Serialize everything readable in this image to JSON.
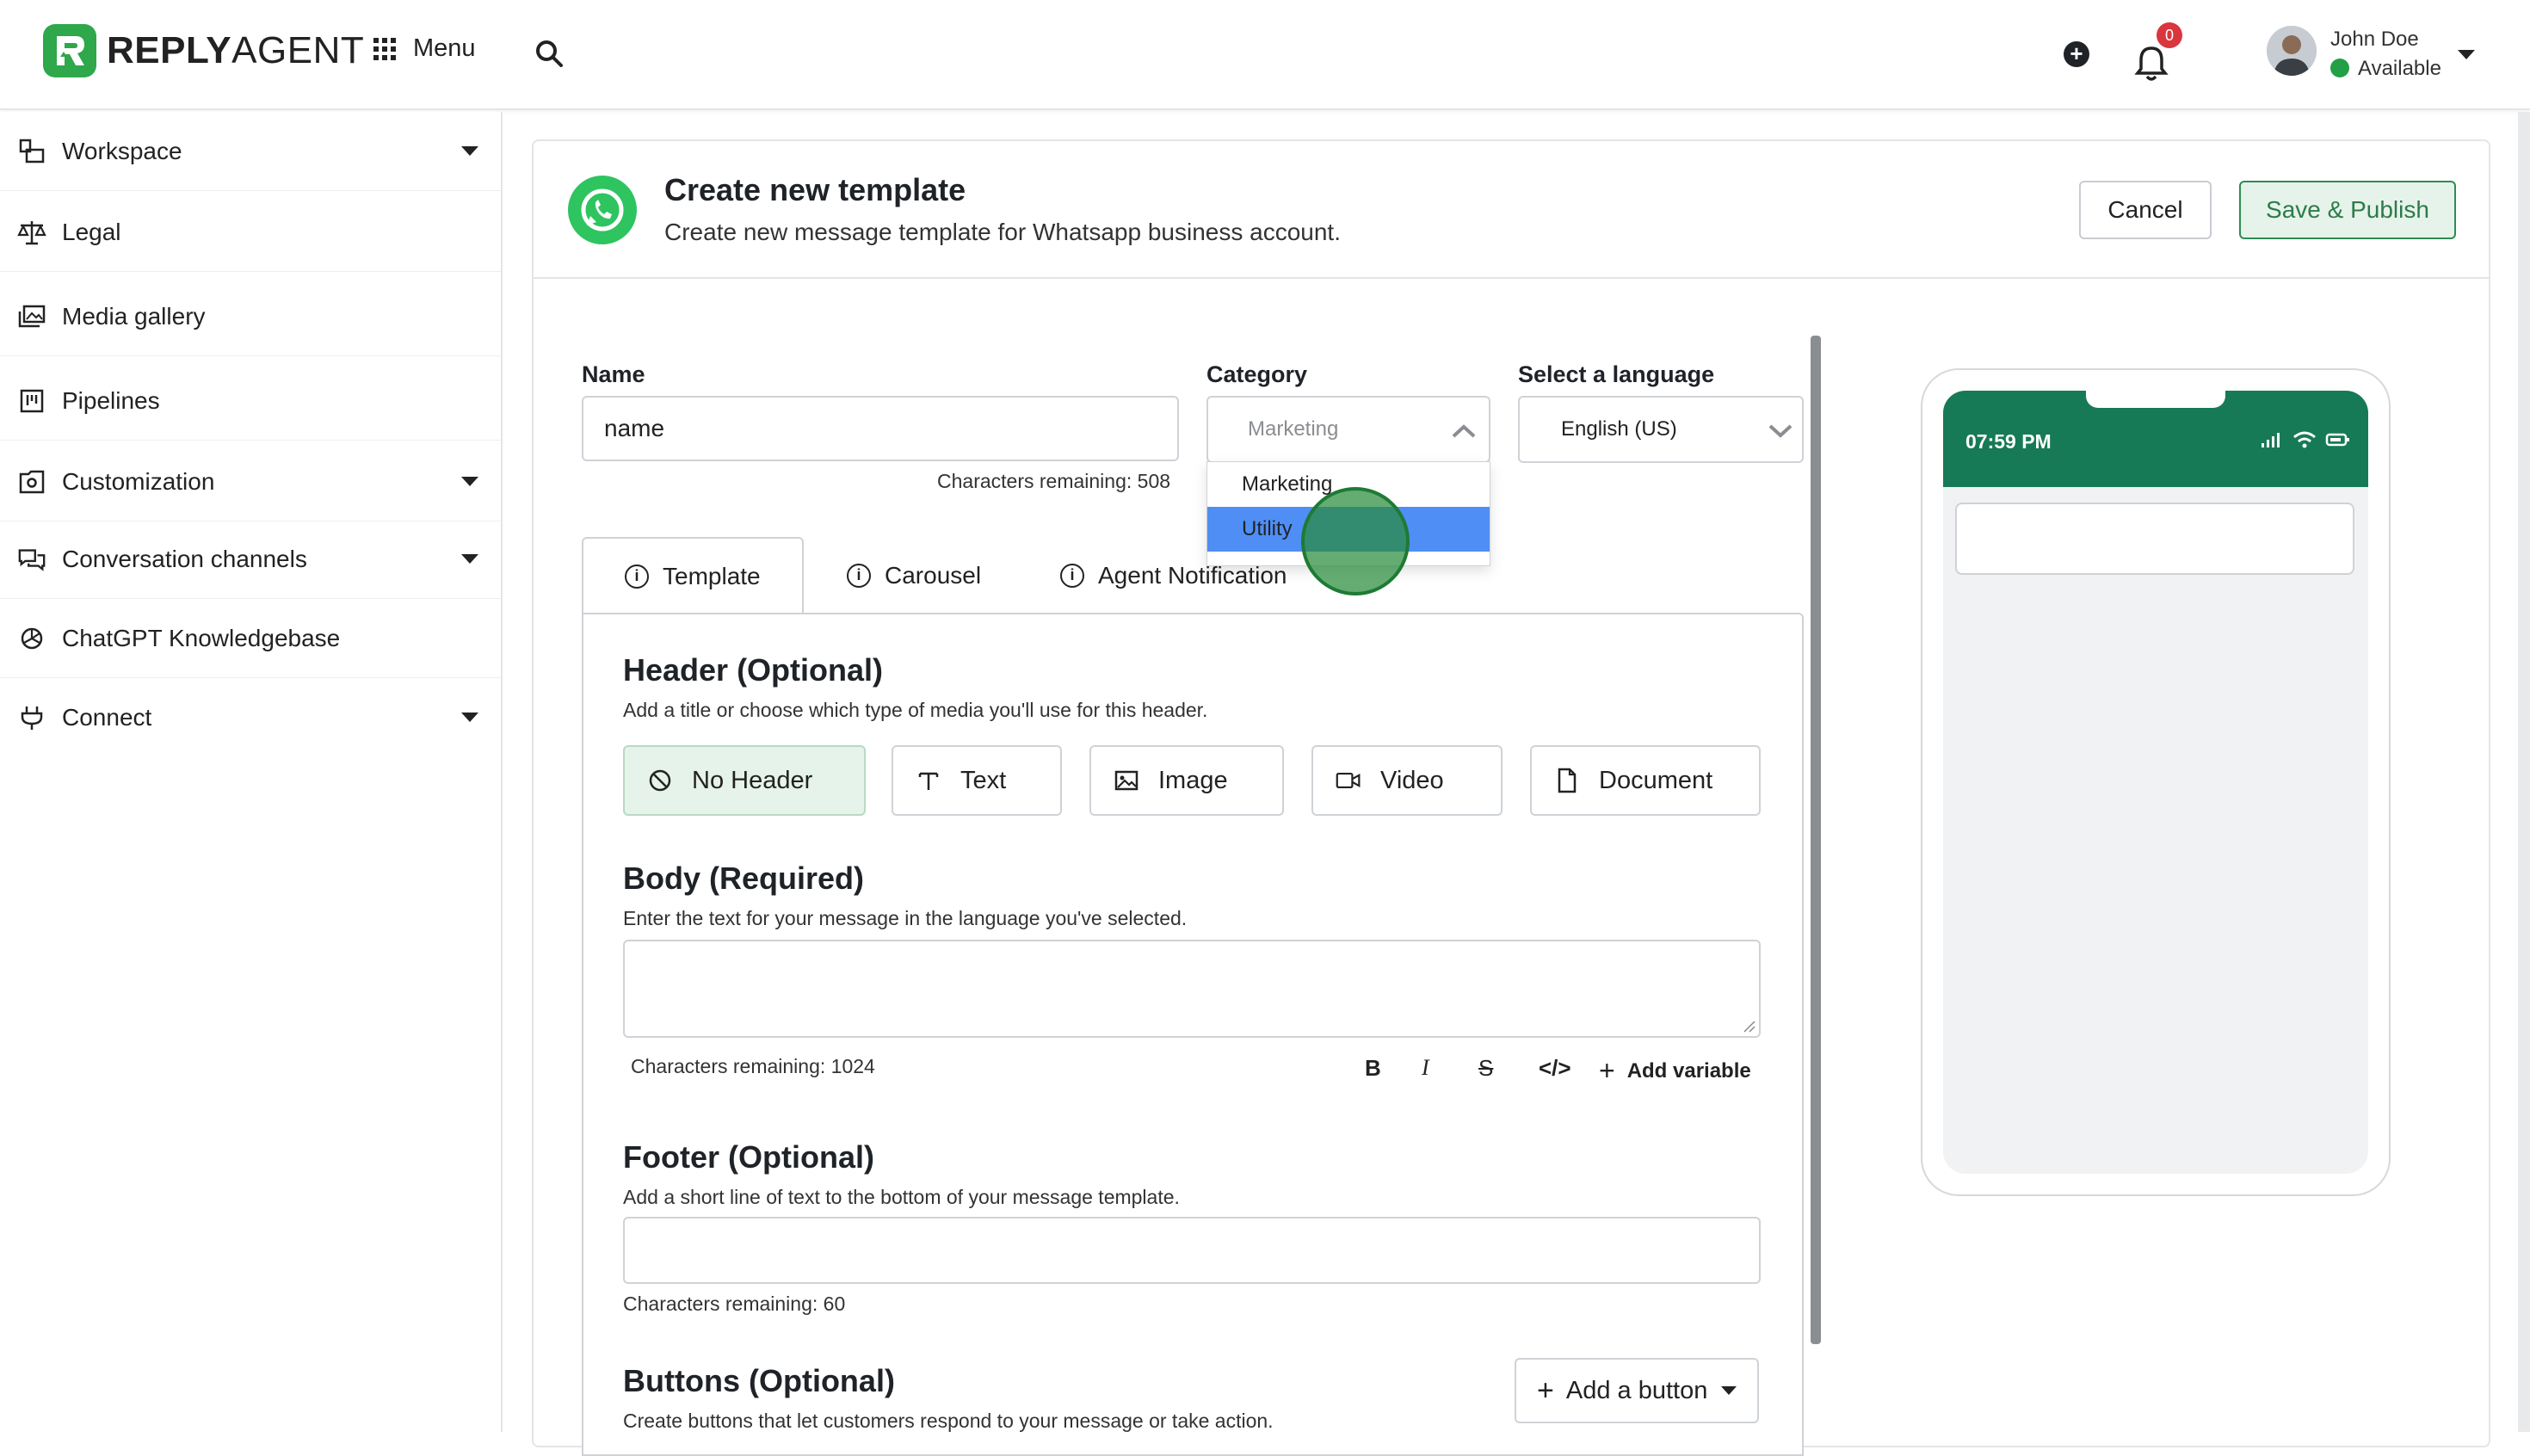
{
  "brand": {
    "name_bold": "REPLY",
    "name_light": "AGENT",
    "color": "#2ea84a"
  },
  "topbar": {
    "menu_label": "Menu",
    "notifications_count": "0",
    "user_name": "John Doe",
    "user_status": "Available"
  },
  "sidebar": {
    "items": [
      {
        "label": "Workspace",
        "icon": "workspace-icon",
        "has_caret": true
      },
      {
        "label": "Legal",
        "icon": "scale-icon",
        "has_caret": false
      },
      {
        "label": "Media gallery",
        "icon": "gallery-icon",
        "has_caret": false
      },
      {
        "label": "Pipelines",
        "icon": "pipeline-icon",
        "has_caret": false
      },
      {
        "label": "Customization",
        "icon": "customization-icon",
        "has_caret": true
      },
      {
        "label": "Conversation channels",
        "icon": "chat-icon",
        "has_caret": true
      },
      {
        "label": "ChatGPT Knowledgebase",
        "icon": "openai-icon",
        "has_caret": false
      },
      {
        "label": "Connect",
        "icon": "plug-icon",
        "has_caret": true
      }
    ]
  },
  "header": {
    "title": "Create new template",
    "subtitle": "Create new message template for Whatsapp business account.",
    "cancel_label": "Cancel",
    "save_label": "Save & Publish"
  },
  "form": {
    "name_label": "Name",
    "name_value": "name",
    "name_remaining": "Characters remaining: 508",
    "category_label": "Category",
    "category_value": "Marketing",
    "category_options": [
      "Marketing",
      "Utility"
    ],
    "category_highlighted": "Utility",
    "language_label": "Select a language",
    "language_value": "English (US)"
  },
  "tabs": [
    {
      "label": "Template",
      "active": true
    },
    {
      "label": "Carousel",
      "active": false
    },
    {
      "label": "Agent Notification",
      "active": false
    }
  ],
  "header_section": {
    "title": "Header (Optional)",
    "subtitle": "Add a title or choose which type of media you'll use for this header.",
    "options": [
      "No Header",
      "Text",
      "Image",
      "Video",
      "Document"
    ],
    "selected": "No Header"
  },
  "body_section": {
    "title": "Body (Required)",
    "subtitle": "Enter the text for your message in the language you've selected.",
    "remaining": "Characters remaining: 1024",
    "add_variable": "Add variable",
    "format_tools": [
      "bold-icon",
      "italic-icon",
      "strikethrough-icon",
      "code-icon"
    ]
  },
  "footer_section": {
    "title": "Footer (Optional)",
    "subtitle": "Add a short line of text to the bottom of your message template.",
    "remaining": "Characters remaining: 60"
  },
  "buttons_section": {
    "title": "Buttons (Optional)",
    "subtitle": "Create buttons that let customers respond to your message or take action.",
    "add_label": "Add a button"
  },
  "preview": {
    "time": "07:59 PM",
    "header_color": "#167a56"
  },
  "colors": {
    "accent_green": "#2d8c54",
    "selected_bg": "#e6f3ea",
    "dropdown_highlight": "#4f8ef5",
    "badge_red": "#d9363e"
  }
}
